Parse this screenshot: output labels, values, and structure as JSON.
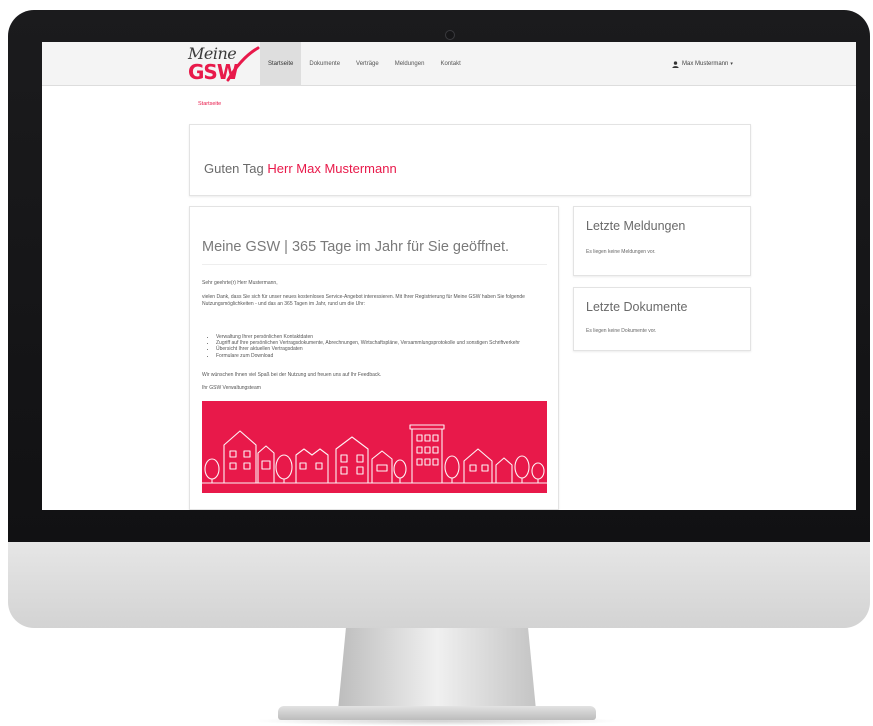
{
  "nav": {
    "logo_top": "Meine",
    "logo_bottom": "GSW",
    "items": [
      {
        "label": "Startseite",
        "active": true
      },
      {
        "label": "Dokumente",
        "active": false
      },
      {
        "label": "Verträge",
        "active": false
      },
      {
        "label": "Meldungen",
        "active": false
      },
      {
        "label": "Kontakt",
        "active": false
      }
    ],
    "user": "Max Mustermann"
  },
  "breadcrumb": "Startseite",
  "welcome": {
    "greeting": "Guten Tag",
    "name": "Herr Max Mustermann"
  },
  "main": {
    "title": "Meine GSW | 365 Tage im Jahr für Sie geöffnet.",
    "salutation": "Sehr geehrte(r) Herr Mustermann,",
    "intro": "vielen Dank, dass Sie sich für unser neues kostenloses Service-Angebot interessieren. Mit Ihrer Registrierung für Meine GSW haben Sie folgende Nutzungsmöglichkeiten - und das an 365 Tagen im Jahr, rund um die Uhr:",
    "features": [
      "Verwaltung Ihrer persönlichen Kontaktdaten",
      "Zugriff auf Ihre persönlichen Vertragsdokumente, Abrechnungen, Wirtschaftspläne, Versammlungsprotokolle und sonstigen Schriftverkehr",
      "Übersicht Ihrer aktuellen Vertragsdaten",
      "Formulare zum Download"
    ],
    "closing": "Wir wünschen Ihnen viel Spaß bei der Nutzung und freuen uns auf Ihr Feedback.",
    "signature": "Ihr GSW Verwaltungsteam"
  },
  "side": {
    "news_title": "Letzte Meldungen",
    "news_text": "Es liegen keine Meldungen vor.",
    "docs_title": "Letzte Dokumente",
    "docs_text": "Es liegen keine Dokumente vor."
  },
  "colors": {
    "accent": "#e8194a",
    "navbar": "#f4f4f4",
    "bezel": "#151517"
  }
}
